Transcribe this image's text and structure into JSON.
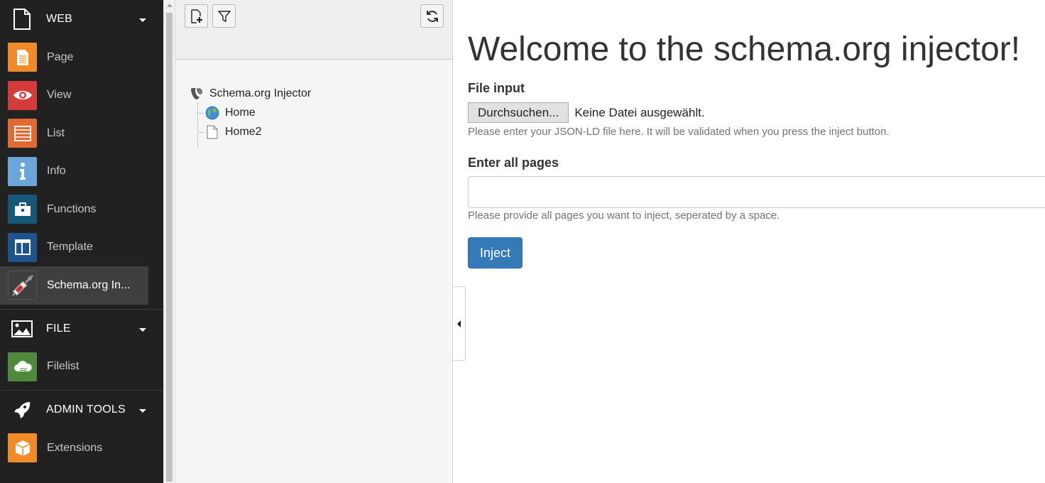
{
  "module_menu": {
    "groups": [
      {
        "label": "WEB",
        "icon": "page-icon",
        "items": [
          {
            "label": "Page",
            "icon": "page-module-icon",
            "color": "#f28a25"
          },
          {
            "label": "View",
            "icon": "eye-icon",
            "color": "#d63b3b"
          },
          {
            "label": "List",
            "icon": "list-icon",
            "color": "#e06a31"
          },
          {
            "label": "Info",
            "icon": "info-icon",
            "color": "#6ba6da"
          },
          {
            "label": "Functions",
            "icon": "toolbox-icon",
            "color": "#17577a"
          },
          {
            "label": "Template",
            "icon": "template-icon",
            "color": "#1e5490"
          },
          {
            "label": "Schema.org In...",
            "icon": "syringe-icon",
            "color": "#3f3f3f",
            "active": true
          }
        ]
      },
      {
        "label": "FILE",
        "icon": "image-icon",
        "items": [
          {
            "label": "Filelist",
            "icon": "cloud-icon",
            "color": "#4f8a3c"
          }
        ]
      },
      {
        "label": "ADMIN TOOLS",
        "icon": "rocket-icon",
        "items": [
          {
            "label": "Extensions",
            "icon": "box-icon",
            "color": "#f28a25"
          }
        ]
      }
    ]
  },
  "tree": {
    "root": {
      "label": "Schema.org Injector",
      "icon": "typo3-logo-icon"
    },
    "children": [
      {
        "label": "Home",
        "icon": "globe-icon"
      },
      {
        "label": "Home2",
        "icon": "document-icon"
      }
    ]
  },
  "content": {
    "title": "Welcome to the schema.org injector!",
    "file_input": {
      "label": "File input",
      "button_label": "Durchsuchen...",
      "no_file_text": "Keine Datei ausgewählt.",
      "help": "Please enter your JSON-LD file here. It will be validated when you press the inject button."
    },
    "pages": {
      "label": "Enter all pages",
      "value": "",
      "help": "Please provide all pages you want to inject, seperated by a space."
    },
    "inject_label": "Inject"
  },
  "colors": {
    "sidebar_bg": "#212121",
    "primary": "#337ab7"
  }
}
